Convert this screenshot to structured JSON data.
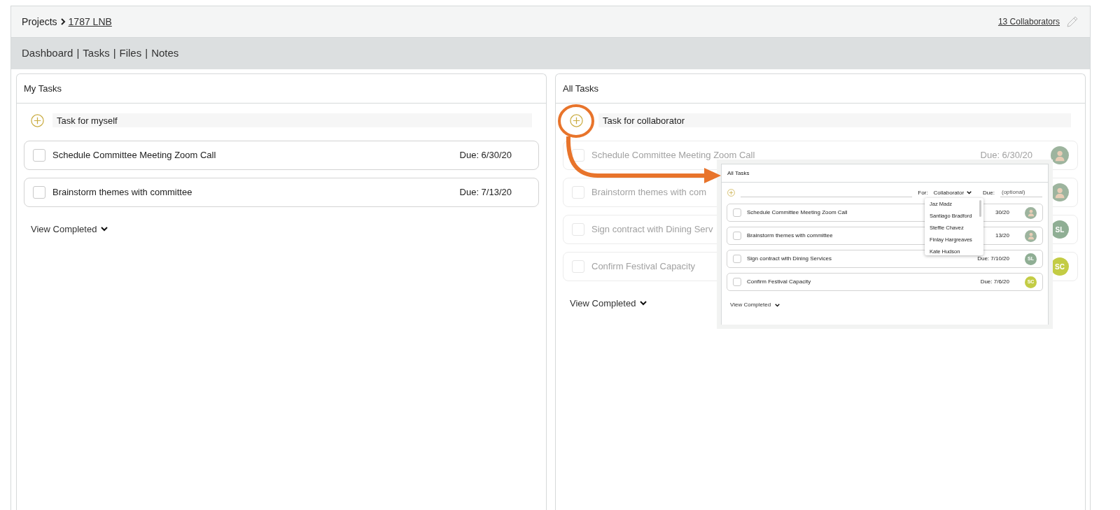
{
  "breadcrumb": {
    "root": "Projects",
    "project": "1787 LNB"
  },
  "collaborators_link": "13 Collaborators",
  "nav": [
    {
      "label": "Dashboard",
      "separator_after": "|"
    },
    {
      "label": "Tasks",
      "separator_after": "|"
    },
    {
      "label": "Files",
      "separator_after": "|"
    },
    {
      "label": "Notes"
    }
  ],
  "my_tasks": {
    "title": "My Tasks",
    "add_placeholder": "Task for myself",
    "tasks": [
      {
        "title": "Schedule Committee Meeting Zoom Call",
        "due": "Due: 6/30/20",
        "checked": false
      },
      {
        "title": "Brainstorm themes with committee",
        "due": "Due: 7/13/20",
        "checked": false
      }
    ],
    "view_completed": "View Completed"
  },
  "all_tasks": {
    "title": "All Tasks",
    "add_placeholder": "Task for collaborator",
    "tasks": [
      {
        "title": "Schedule Committee Meeting Zoom Call",
        "due": "Due: 6/30/20",
        "checked": false,
        "avatar": {
          "kind": "photo"
        }
      },
      {
        "title": "Brainstorm themes with com",
        "checked": false,
        "avatar": {
          "kind": "photo"
        }
      },
      {
        "title": "Sign contract with Dining Serv",
        "checked": false,
        "avatar": {
          "kind": "initials",
          "initials": "SL",
          "color": "#8fae94"
        }
      },
      {
        "title": "Confirm Festival Capacity",
        "checked": false,
        "avatar": {
          "kind": "initials",
          "initials": "SC",
          "color": "#c3cc44"
        }
      }
    ],
    "view_completed": "View Completed"
  },
  "inset": {
    "title": "All Tasks",
    "for_label": "For:",
    "for_value": "Collaborator",
    "due_label": "Due:",
    "due_placeholder": "(optional)",
    "dropdown_options": [
      "Jaz Madz",
      "Santiago Bradford",
      "Steffie Chavez",
      "Finlay Hargreaves",
      "Kate Hudson"
    ],
    "tasks": [
      {
        "title": "Schedule Committee Meeting Zoom Call",
        "due": "30/20",
        "checked": false,
        "avatar": {
          "kind": "photo"
        }
      },
      {
        "title": "Brainstorm themes with committee",
        "due": "13/20",
        "checked": false,
        "avatar": {
          "kind": "photo"
        }
      },
      {
        "title": "Sign contract with Dining Services",
        "due": "Due: 7/10/20",
        "checked": false,
        "avatar": {
          "kind": "initials",
          "initials": "SL",
          "color": "#8fae94"
        }
      },
      {
        "title": "Confirm Festival Capacity",
        "due": "Due: 7/6/20",
        "checked": false,
        "avatar": {
          "kind": "initials",
          "initials": "SC",
          "color": "#c3cc44"
        }
      }
    ],
    "view_completed": "View Completed"
  }
}
